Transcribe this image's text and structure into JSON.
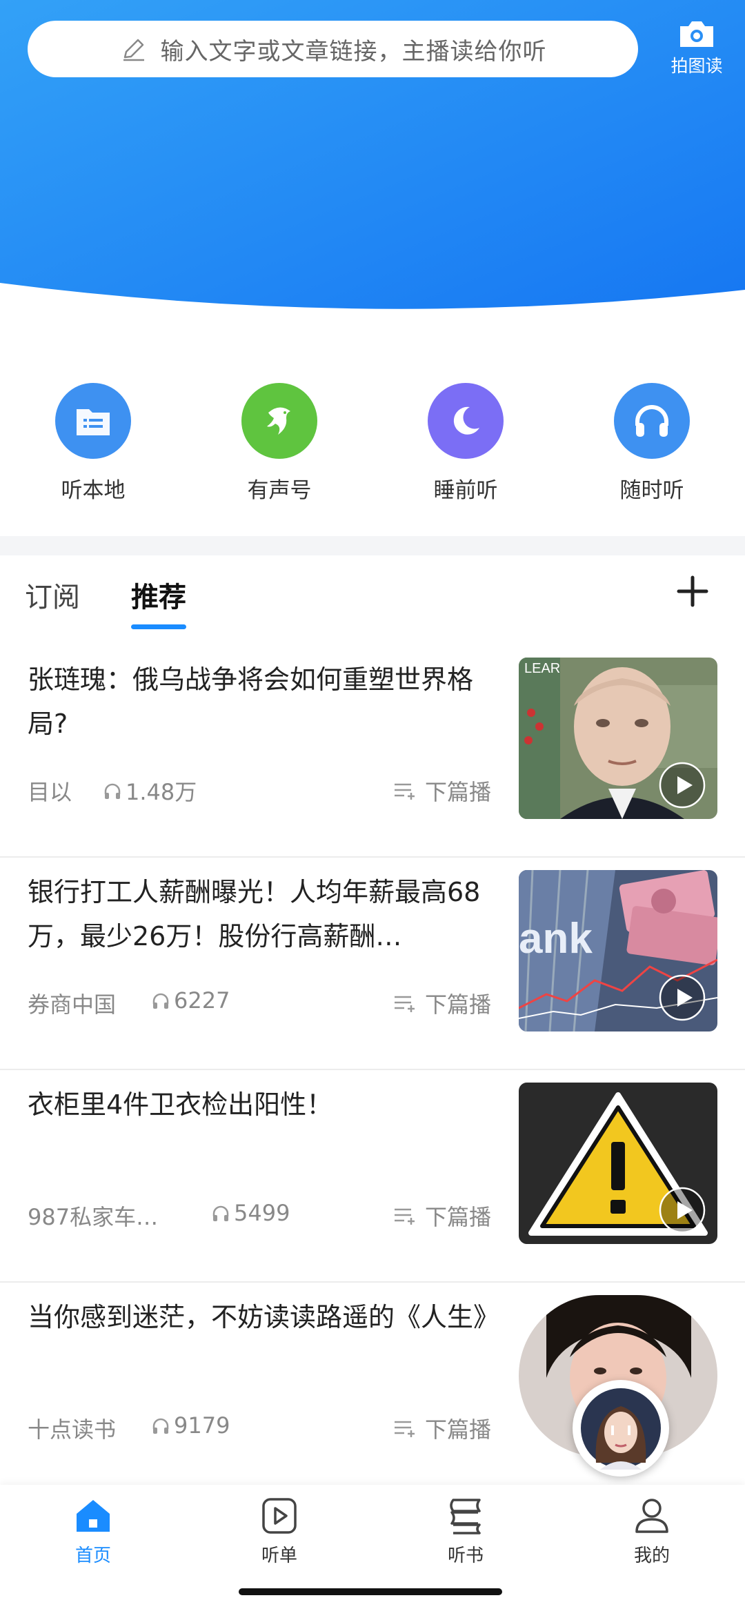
{
  "search": {
    "placeholder": "输入文字或文章链接，主播读给你听",
    "icon": "pencil-icon"
  },
  "photo_read": {
    "label": "拍图读",
    "icon": "camera-icon"
  },
  "shortcuts": [
    {
      "label": "听本地",
      "icon": "file-list-icon",
      "color": "#3a8ff0"
    },
    {
      "label": "有声号",
      "icon": "dolphin-icon",
      "color": "#5ac43c"
    },
    {
      "label": "睡前听",
      "icon": "moon-icon",
      "color": "#7a6cf5"
    },
    {
      "label": "随时听",
      "icon": "headphones-icon",
      "color": "#3a8ff0"
    }
  ],
  "tabs": [
    {
      "label": "订阅",
      "active": false
    },
    {
      "label": "推荐",
      "active": true
    }
  ],
  "articles": [
    {
      "title": "张琏瑰：俄乌战争将会如何重塑世界格局?",
      "source": "目以",
      "plays": "1.48万",
      "next_label": "下篇播"
    },
    {
      "title": "银行打工人薪酬曝光！人均年薪最高68万，最少26万！股份行高薪酬…",
      "source": "券商中国",
      "plays": "6227",
      "next_label": "下篇播"
    },
    {
      "title": "衣柜里4件卫衣检出阳性！",
      "source": "987私家车…",
      "plays": "5499",
      "next_label": "下篇播"
    },
    {
      "title": "当你感到迷茫，不妨读读路遥的《人生》",
      "source": "十点读书",
      "plays": "9179",
      "next_label": "下篇播"
    }
  ],
  "bottom_nav": [
    {
      "label": "首页",
      "icon": "home-icon",
      "active": true
    },
    {
      "label": "听单",
      "icon": "play-square-icon",
      "active": false
    },
    {
      "label": "听书",
      "icon": "book-stack-icon",
      "active": false
    },
    {
      "label": "我的",
      "icon": "user-icon",
      "active": false
    }
  ],
  "colors": {
    "brand_blue": "#1a8cff",
    "hero_top": "#2f98f5",
    "hero_bottom": "#1a7cf3"
  }
}
